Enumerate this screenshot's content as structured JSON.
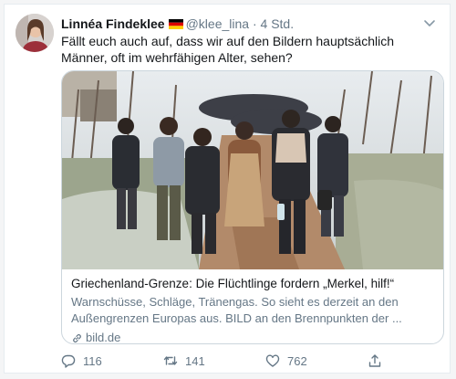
{
  "tweet": {
    "author_name": "Linnéa Findeklee",
    "handle": "@klee_lina",
    "separator": "·",
    "time": "4 Std.",
    "text": "Fällt euch auch auf, dass wir auf den Bildern hauptsächlich Männer, oft im wehrfähigen Alter, sehen?"
  },
  "card": {
    "title": "Griechenland-Grenze: Die Flüchtlinge fordern „Merkel, hilf!“",
    "description": "Warnschüsse, Schläge, Tränengas. So sieht es derzeit an den Außengrenzen Europas aus. BILD an den Brennpunkten der ...",
    "domain": "bild.de"
  },
  "actions": {
    "reply_count": "116",
    "retweet_count": "141",
    "like_count": "762"
  },
  "icons": {
    "flag": "germany-flag-icon",
    "caret": "chevron-down-icon",
    "reply": "reply-icon",
    "retweet": "retweet-icon",
    "like": "heart-icon",
    "share": "share-icon",
    "link": "link-icon"
  },
  "colors": {
    "primary_text": "#14171a",
    "secondary_text": "#657786",
    "border": "#ccd6dd"
  }
}
